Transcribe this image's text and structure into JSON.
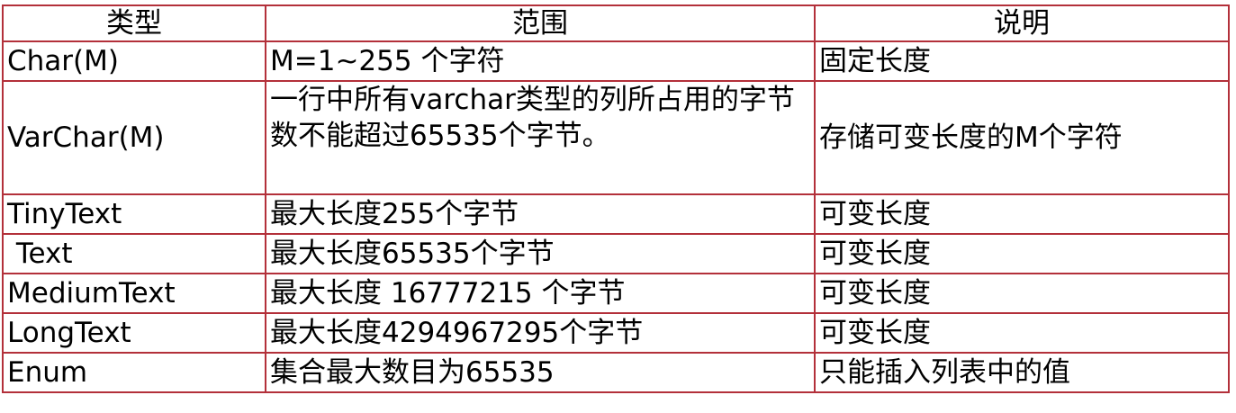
{
  "table": {
    "headers": [
      "类型",
      "范围",
      "说明"
    ],
    "rows": [
      [
        "Char(M)",
        "M=1~255 个字符",
        "固定长度"
      ],
      [
        "VarChar(M)",
        "一行中所有varchar类型的列所占用的字节数不能超过65535个字节。",
        "存储可变长度的M个字符"
      ],
      [
        "TinyText",
        "最大长度255个字节",
        "可变长度"
      ],
      [
        " Text",
        "最大长度65535个字节",
        "可变长度"
      ],
      [
        "MediumText",
        "最大长度 16777215 个字节",
        "可变长度"
      ],
      [
        "LongText",
        "最大长度4294967295个字节",
        "可变长度"
      ],
      [
        "Enum",
        "集合最大数目为65535",
        "只能插入列表中的值"
      ]
    ]
  },
  "colors": {
    "border": "#b3303a",
    "text": "#000000",
    "background": "#ffffff"
  }
}
